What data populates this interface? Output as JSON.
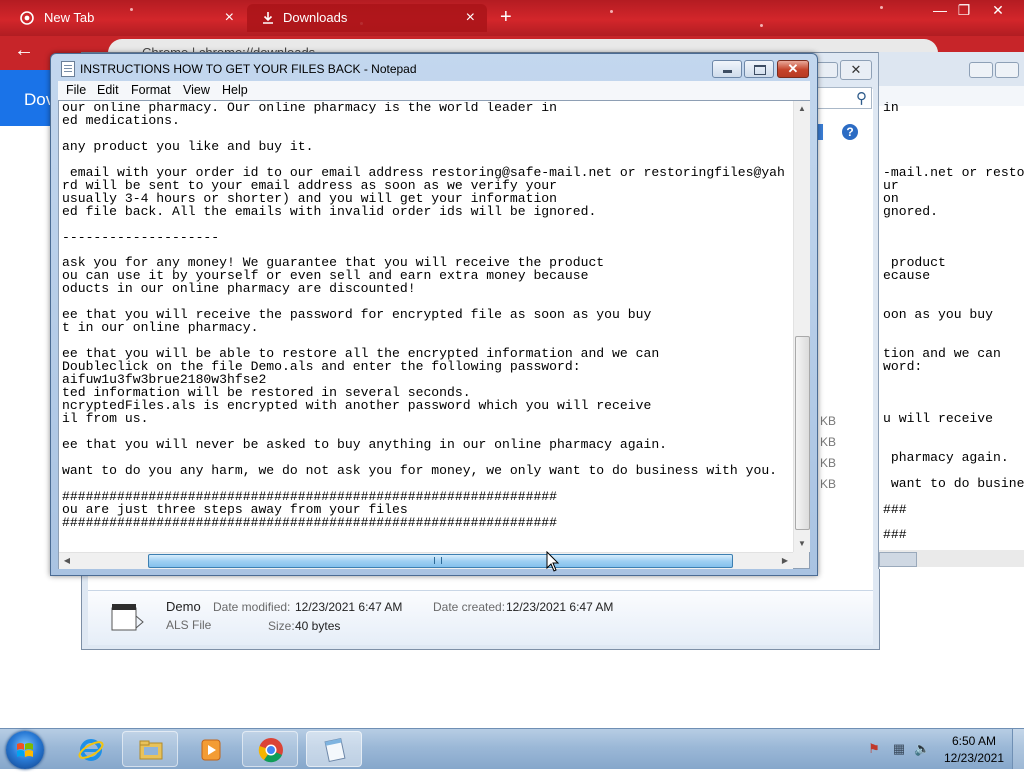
{
  "chrome": {
    "tabs": [
      {
        "label": "New Tab",
        "close": "×"
      },
      {
        "label": "Downloads",
        "close": "×"
      }
    ],
    "new_tab": "+",
    "window_controls": {
      "minimize": "—",
      "maximize": "❐",
      "close": "✕"
    },
    "back": "←",
    "address": "Chrome | chrome://downloads",
    "page_heading": "Dov"
  },
  "explorer": {
    "close": "✕",
    "search_icon": "⚲",
    "help": "?",
    "sizes": [
      "KB",
      "KB",
      "KB",
      "KB"
    ],
    "details": {
      "name": "Demo",
      "type": "ALS File",
      "date_modified_label": "Date modified:",
      "date_modified": "12/23/2021 6:47 AM",
      "date_created_label": "Date created:",
      "date_created": "12/23/2021 6:47 AM",
      "size_label": "Size:",
      "size": "40 bytes"
    }
  },
  "notepad2_text": "in\n\n\n\n\n-mail.net or resto\nur\non\ngnored.\n\n\n\n product\necause\n\n\noon as you buy\n\n\ntion and we can\nword:\n\n\n\nu will receive\n\n\n pharmacy again.\n\n want to do busine\n\n###\n\n###",
  "notepad": {
    "title": "INSTRUCTIONS HOW TO GET YOUR FILES BACK - Notepad",
    "close": "✕",
    "menu": {
      "file": "File",
      "edit": "Edit",
      "format": "Format",
      "view": "View",
      "help": "Help"
    },
    "text": "our online pharmacy. Our online pharmacy is the world leader in\ned medications.\n\nany product you like and buy it.\n\n email with your order id to our email address restoring@safe-mail.net or restoringfiles@yah\nrd will be sent to your email address as soon as we verify your\nusually 3-4 hours or shorter) and you will get your information\ned file back. All the emails with invalid order ids will be ignored.\n\n--------------------\n\nask you for any money! We guarantee that you will receive the product\nou can use it by yourself or even sell and earn extra money because\noducts in our online pharmacy are discounted!\n\nee that you will receive the password for encrypted file as soon as you buy\nt in our online pharmacy.\n\nee that you will be able to restore all the encrypted information and we can\nDoubleclick on the file Demo.als and enter the following password:\naifuw1u3fw3brue2180w3hfse2\nted information will be restored in several seconds.\nncryptedFiles.als is encrypted with another password which you will receive\nil from us.\n\nee that you will never be asked to buy anything in our online pharmacy again.\n\nwant to do you any harm, we do not ask you for money, we only want to do business with you.\n\n###############################################################\nou are just three steps away from your files\n###############################################################"
  },
  "taskbar": {
    "apps": [
      "internet-explorer",
      "windows-explorer",
      "media-player",
      "chrome",
      "notepad"
    ],
    "clock_time": "6:50 AM",
    "clock_date": "12/23/2021"
  }
}
